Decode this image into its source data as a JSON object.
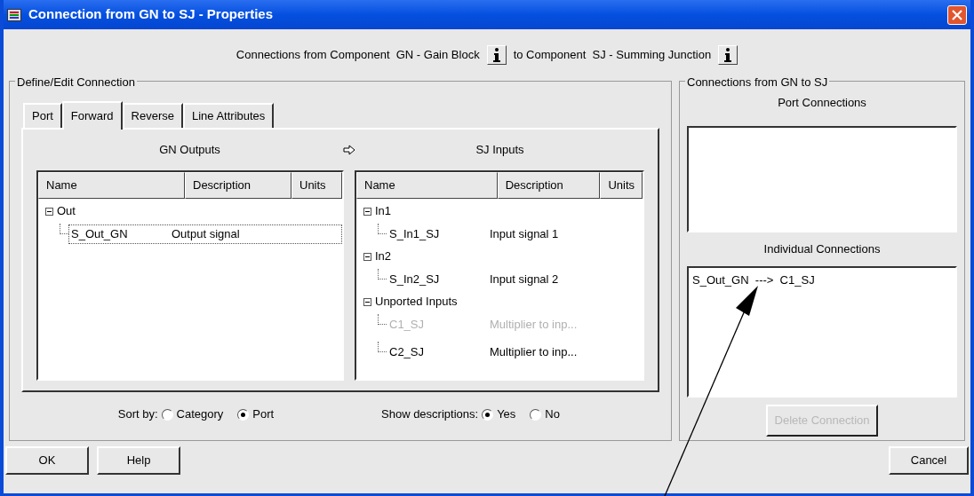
{
  "window": {
    "title": "Connection from GN to SJ - Properties"
  },
  "header": {
    "from_label": "Connections from Component  GN - Gain Block",
    "to_label": "to Component  SJ - Summing Junction"
  },
  "define_group": {
    "title": "Define/Edit Connection",
    "tabs": [
      {
        "label": "Port",
        "selected": false
      },
      {
        "label": "Forward",
        "selected": true
      },
      {
        "label": "Reverse",
        "selected": false
      },
      {
        "label": "Line Attributes",
        "selected": false
      }
    ],
    "outputs": {
      "title": "GN Outputs",
      "columns": [
        "Name",
        "Description",
        "Units"
      ],
      "tree": [
        {
          "name": "Out",
          "expanded": true,
          "children": [
            {
              "name": "S_Out_GN",
              "description": "Output signal",
              "disabled": false,
              "selected": true
            }
          ]
        }
      ]
    },
    "inputs": {
      "title": "SJ Inputs",
      "columns": [
        "Name",
        "Description",
        "Units"
      ],
      "tree": [
        {
          "name": "In1",
          "expanded": true,
          "children": [
            {
              "name": "S_In1_SJ",
              "description": "Input signal 1",
              "disabled": false,
              "selected": false
            }
          ]
        },
        {
          "name": "In2",
          "expanded": true,
          "children": [
            {
              "name": "S_In2_SJ",
              "description": "Input signal 2",
              "disabled": false,
              "selected": false
            }
          ]
        },
        {
          "name": "Unported Inputs",
          "expanded": true,
          "children": [
            {
              "name": "C1_SJ",
              "description": "Multiplier to inp...",
              "disabled": true,
              "selected": false
            },
            {
              "name": "C2_SJ",
              "description": "Multiplier to inp...",
              "disabled": false,
              "selected": false
            }
          ]
        }
      ]
    },
    "sort_by": {
      "label": "Sort by:",
      "options": [
        {
          "label": "Category",
          "selected": false
        },
        {
          "label": "Port",
          "selected": true
        }
      ]
    },
    "show_descriptions": {
      "label": "Show descriptions:",
      "options": [
        {
          "label": "Yes",
          "selected": true
        },
        {
          "label": "No",
          "selected": false
        }
      ]
    }
  },
  "connections_group": {
    "title": "Connections from GN to SJ",
    "port_connections": {
      "title": "Port Connections"
    },
    "individual_connections": {
      "title": "Individual Connections",
      "items": [
        "S_Out_GN  --->  C1_SJ"
      ]
    },
    "delete_button": {
      "label": "Delete Connection",
      "disabled": true
    }
  },
  "buttons": [
    {
      "label": "OK"
    },
    {
      "label": "Help"
    },
    {
      "label": "Cancel"
    }
  ]
}
